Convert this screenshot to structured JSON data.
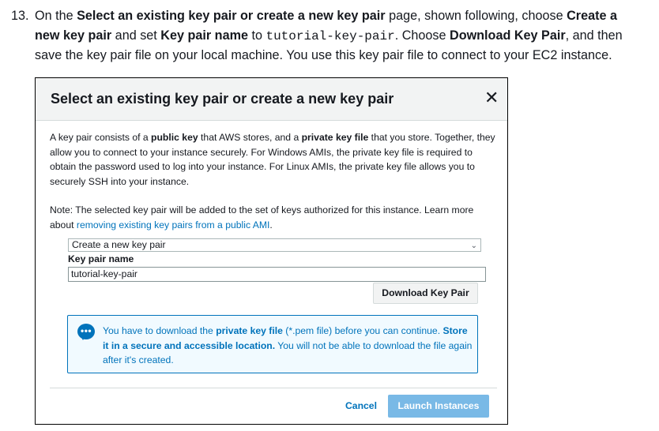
{
  "step": {
    "number": "13.",
    "t1": "On the ",
    "b1": "Select an existing key pair or create a new key pair",
    "t2": " page, shown following, choose ",
    "b2": "Create a new key pair",
    "t3": " and set ",
    "b3": "Key pair name",
    "t4": " to ",
    "code": "tutorial-key-pair",
    "t5": ". Choose ",
    "b4": "Download Key Pair",
    "t6": ", and then save the key pair file on your local machine. You use this key pair file to connect to your EC2 instance."
  },
  "dialog": {
    "title": "Select an existing key pair or create a new key pair",
    "close": "✕",
    "intro": {
      "t1": "A key pair consists of a ",
      "b1": "public key",
      "t2": " that AWS stores, and a ",
      "b2": "private key file",
      "t3": " that you store. Together, they allow you to connect to your instance securely. For Windows AMIs, the private key file is required to obtain the password used to log into your instance. For Linux AMIs, the private key file allows you to securely SSH into your instance."
    },
    "note": {
      "t1": "Note: The selected key pair will be added to the set of keys authorized for this instance. Learn more about ",
      "link": "removing existing key pairs from a public AMI",
      "t2": "."
    },
    "select_value": "Create a new key pair",
    "name_label": "Key pair name",
    "name_value": "tutorial-key-pair",
    "download_button": "Download Key Pair",
    "info": {
      "t1": "You have to download the ",
      "b1": "private key file",
      "t2": " (*.pem file) before you can continue. ",
      "b2": "Store it in a secure and accessible location.",
      "t3": " You will not be able to download the file again after it's created."
    },
    "cancel": "Cancel",
    "launch": "Launch Instances"
  },
  "colors": {
    "link": "#0073bb",
    "info_bg": "#f1faff",
    "launch_disabled": "#79b9e6",
    "header_bg": "#f2f3f3"
  },
  "icons": {
    "info": "chat-bubble-ellipsis-icon",
    "close": "close-icon",
    "dropdown": "chevron-down-icon"
  }
}
